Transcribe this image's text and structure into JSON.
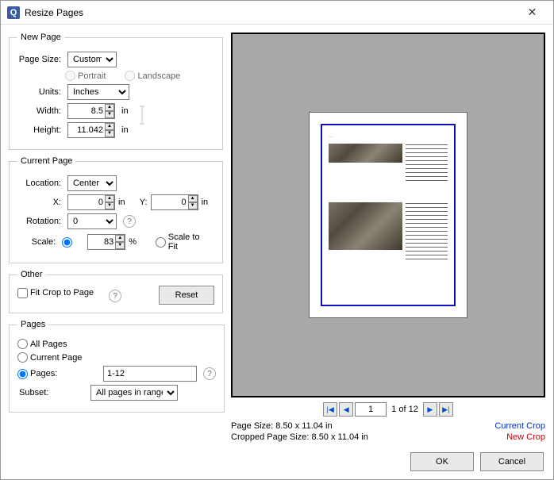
{
  "window": {
    "title": "Resize Pages"
  },
  "newPage": {
    "legend": "New Page",
    "pageSizeLabel": "Page Size:",
    "pageSizeValue": "Custom",
    "portrait": "Portrait",
    "landscape": "Landscape",
    "unitsLabel": "Units:",
    "unitsValue": "Inches",
    "widthLabel": "Width:",
    "widthValue": "8.5",
    "widthUnit": "in",
    "heightLabel": "Height:",
    "heightValue": "11.042",
    "heightUnit": "in"
  },
  "currentPage": {
    "legend": "Current Page",
    "locationLabel": "Location:",
    "locationValue": "Center",
    "xLabel": "X:",
    "xValue": "0",
    "xUnit": "in",
    "yLabel": "Y:",
    "yValue": "0",
    "yUnit": "in",
    "rotationLabel": "Rotation:",
    "rotationValue": "0",
    "scaleLabel": "Scale:",
    "scaleValue": "83",
    "scalePct": "%",
    "scaleToFit": "Scale to Fit"
  },
  "other": {
    "legend": "Other",
    "fitCrop": "Fit Crop to Page",
    "reset": "Reset"
  },
  "pages": {
    "legend": "Pages",
    "allPages": "All Pages",
    "currentPage": "Current Page",
    "pagesRange": "Pages:",
    "rangeValue": "1-12",
    "subsetLabel": "Subset:",
    "subsetValue": "All pages in range"
  },
  "pager": {
    "current": "1",
    "total": "1 of 12"
  },
  "info": {
    "pageSizeLabel": "Page Size:",
    "pageSizeValue": "8.50 x 11.04 in",
    "croppedLabel": "Cropped Page Size:",
    "croppedValue": "8.50 x 11.04 in",
    "currentCrop": "Current Crop",
    "newCrop": "New Crop"
  },
  "footer": {
    "ok": "OK",
    "cancel": "Cancel"
  }
}
